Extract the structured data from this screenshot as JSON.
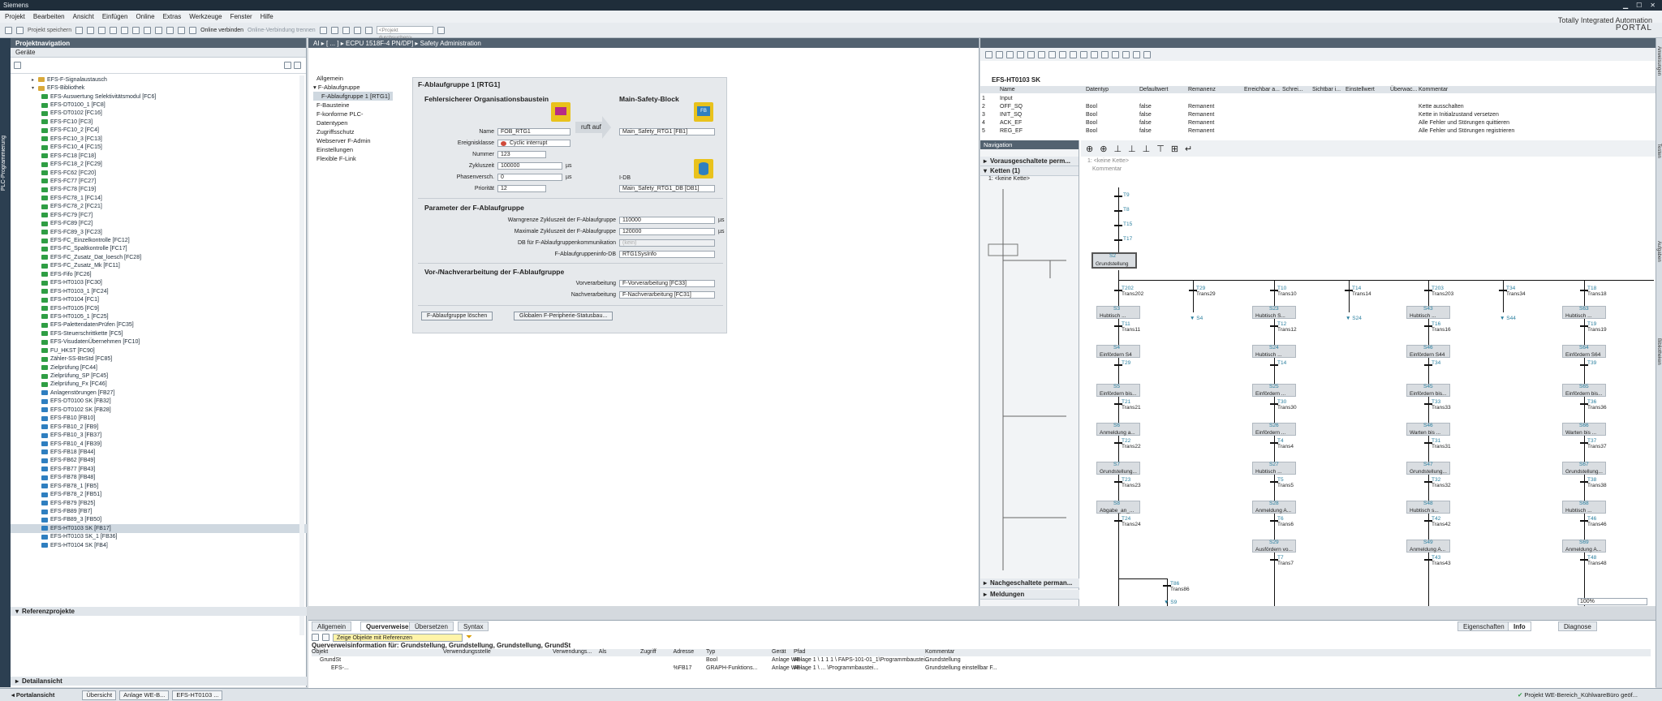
{
  "titlebar": {
    "title": "Siemens"
  },
  "menubar": {
    "items": [
      "Projekt",
      "Bearbeiten",
      "Ansicht",
      "Einfügen",
      "Online",
      "Extras",
      "Werkzeuge",
      "Fenster",
      "Hilfe"
    ]
  },
  "toolbar": {
    "save_label": "Projekt speichern",
    "online_label": "Online verbinden",
    "offline_label": "Online-Verbindung trennen",
    "search_placeholder": "<Projekt durchsuchen>"
  },
  "brand": {
    "line1": "Totally Integrated Automation",
    "line2": "PORTAL"
  },
  "sidestrip": {
    "label": "PLC-Programmierung"
  },
  "projnav": {
    "title": "Projektnavigation",
    "tab": "Geräte",
    "items": [
      {
        "label": "EFS-F-Signalaustausch",
        "kind": "folder",
        "arrow": "▸"
      },
      {
        "label": "EFS-Bibliothek",
        "kind": "folder",
        "arrow": "▾"
      },
      {
        "label": "EFS-Auswertung Selektivitätsmodul [FC6]",
        "kind": "fc"
      },
      {
        "label": "EFS-DT0100_1 [FC8]",
        "kind": "fc"
      },
      {
        "label": "EFS-DT0102 [FC16]",
        "kind": "fc"
      },
      {
        "label": "EFS-FC10 [FC3]",
        "kind": "fc"
      },
      {
        "label": "EFS-FC10_2 [FC4]",
        "kind": "fc"
      },
      {
        "label": "EFS-FC10_3 [FC13]",
        "kind": "fc"
      },
      {
        "label": "EFS-FC10_4 [FC15]",
        "kind": "fc"
      },
      {
        "label": "EFS-FC18 [FC18]",
        "kind": "fc"
      },
      {
        "label": "EFS-FC18_2 [FC29]",
        "kind": "fc"
      },
      {
        "label": "EFS-FC62 [FC20]",
        "kind": "fc"
      },
      {
        "label": "EFS-FC77 [FC27]",
        "kind": "fc"
      },
      {
        "label": "EFS-FC78 [FC19]",
        "kind": "fc"
      },
      {
        "label": "EFS-FC78_1 [FC14]",
        "kind": "fc"
      },
      {
        "label": "EFS-FC78_2 [FC21]",
        "kind": "fc"
      },
      {
        "label": "EFS-FC79 [FC7]",
        "kind": "fc"
      },
      {
        "label": "EFS-FC89 [FC2]",
        "kind": "fc"
      },
      {
        "label": "EFS-FC89_3 [FC23]",
        "kind": "fc"
      },
      {
        "label": "EFS-FC_Einzelkontrolle [FC12]",
        "kind": "fc"
      },
      {
        "label": "EFS-FC_Spaltkontrolle [FC17]",
        "kind": "fc"
      },
      {
        "label": "EFS-FC_Zusatz_Dat_loesch [FC28]",
        "kind": "fc"
      },
      {
        "label": "EFS-FC_Zusatz_Mk [FC11]",
        "kind": "fc"
      },
      {
        "label": "EFS-Fifo [FC26]",
        "kind": "fc"
      },
      {
        "label": "EFS-HT0103 [FC30]",
        "kind": "fc"
      },
      {
        "label": "EFS-HT0103_1 [FC24]",
        "kind": "fc"
      },
      {
        "label": "EFS-HT0104 [FC1]",
        "kind": "fc"
      },
      {
        "label": "EFS-HT0105 [FC9]",
        "kind": "fc"
      },
      {
        "label": "EFS-HT0105_1 [FC25]",
        "kind": "fc"
      },
      {
        "label": "EFS-PalettendatenPrüfen [FC35]",
        "kind": "fc"
      },
      {
        "label": "EFS-Steuerschrittkette [FC5]",
        "kind": "fc"
      },
      {
        "label": "EFS-VisudatenÜbernehmen [FC10]",
        "kind": "fc"
      },
      {
        "label": "FU_HKST [FC90]",
        "kind": "fc"
      },
      {
        "label": "Zähler-SS-BtrStd [FC85]",
        "kind": "fc"
      },
      {
        "label": "Zielprüfung [FC44]",
        "kind": "fc"
      },
      {
        "label": "Zielprüfung_SP [FC45]",
        "kind": "fc"
      },
      {
        "label": "Zielprüfung_Fx [FC46]",
        "kind": "fc"
      },
      {
        "label": "Anlagenstörungen [FB27]",
        "kind": "fb"
      },
      {
        "label": "EFS-DT0100 SK [FB32]",
        "kind": "fb"
      },
      {
        "label": "EFS-DT0102 SK [FB28]",
        "kind": "fb"
      },
      {
        "label": "EFS-FB10 [FB10]",
        "kind": "fb"
      },
      {
        "label": "EFS-FB10_2 [FB9]",
        "kind": "fb"
      },
      {
        "label": "EFS-FB10_3 [FB37]",
        "kind": "fb"
      },
      {
        "label": "EFS-FB10_4 [FB39]",
        "kind": "fb"
      },
      {
        "label": "EFS-FB18 [FB44]",
        "kind": "fb"
      },
      {
        "label": "EFS-FB62 [FB49]",
        "kind": "fb"
      },
      {
        "label": "EFS-FB77 [FB43]",
        "kind": "fb"
      },
      {
        "label": "EFS-FB78 [FB48]",
        "kind": "fb"
      },
      {
        "label": "EFS-FB78_1 [FB5]",
        "kind": "fb"
      },
      {
        "label": "EFS-FB78_2 [FB51]",
        "kind": "fb"
      },
      {
        "label": "EFS-FB79 [FB25]",
        "kind": "fb"
      },
      {
        "label": "EFS-FB89 [FB7]",
        "kind": "fb"
      },
      {
        "label": "EFS-FB89_3 [FB50]",
        "kind": "fb"
      },
      {
        "label": "EFS-HT0103 SK [FB17]",
        "kind": "fb",
        "selected": true
      },
      {
        "label": "EFS-HT0103 SK_1 [FB36]",
        "kind": "fb"
      },
      {
        "label": "EFS-HT0104 SK [FB4]",
        "kind": "fb"
      }
    ],
    "ref_title": "Referenzprojekte",
    "detail_title": "Detailansicht"
  },
  "editor1": {
    "breadcrumb": "AI ▸ [ ... ] ▸ ECPU 1518F-4 PN/DP] ▸ Safety Administration",
    "nav": [
      {
        "label": "Allgemein"
      },
      {
        "label": "F-Ablaufgruppe",
        "arrow": "▾"
      },
      {
        "label": "F-Ablaufgruppe 1 [RTG1]",
        "indent": true,
        "selected": true
      },
      {
        "label": "F-Bausteine"
      },
      {
        "label": "F-konforme PLC-Datentypen"
      },
      {
        "label": "Zugriffsschutz"
      },
      {
        "label": "Webserver F-Admin"
      },
      {
        "label": "Einstellungen"
      },
      {
        "label": "Flexible F-Link"
      }
    ],
    "group_title": "F-Ablaufgruppe 1 [RTG1]",
    "ob_section": "Fehlersicherer Organisationsbaustein",
    "main_section": "Main-Safety-Block",
    "calls_label": "ruft auf",
    "fields": {
      "name_label": "Name",
      "name": "FOB_RTG1",
      "event_label": "Ereignisklasse",
      "event": "Cyclic interrupt",
      "number_label": "Nummer",
      "number": "123",
      "cycle_label": "Zykluszeit",
      "cycle": "100000",
      "cycle_unit": "µs",
      "phase_label": "Phasenversch.",
      "phase": "0",
      "phase_unit": "µs",
      "prio_label": "Priorität",
      "prio": "12"
    },
    "main_block": "Main_Safety_RTG1 [FB1]",
    "idb_label": "I-DB",
    "idb": "Main_Safety_RTG1_DB [DB1]",
    "params_section": "Parameter der F-Ablaufgruppe",
    "params": [
      {
        "label": "Warngrenze Zykluszeit der F-Ablaufgruppe",
        "value": "110000",
        "unit": "µs"
      },
      {
        "label": "Maximale Zykluszeit der F-Ablaufgruppe",
        "value": "120000",
        "unit": "µs"
      },
      {
        "label": "DB für F-Ablaufgruppenkommunikation",
        "value": "(kein)",
        "unit": ""
      },
      {
        "label": "F-Ablaufgruppeninfo-DB",
        "value": "RTG1SysInfo",
        "unit": ""
      }
    ],
    "prepost_section": "Vor-/Nachverarbeitung der F-Ablaufgruppe",
    "pre_label": "Vorverarbeitung",
    "pre": "F-Vorverarbeitung [FC33]",
    "post_label": "Nachverarbeitung",
    "post": "F-Nachverarbeitung [FC31]",
    "delete_btn": "F-Ablaufgruppe löschen",
    "periph_btn": "Globalen F-Peripherie-Statusbau..."
  },
  "editor2": {
    "block_title": "EFS-HT0103 SK",
    "iface_headers": [
      "Name",
      "Datentyp",
      "Defaultwert",
      "Remanenz",
      "Erreichbar a...",
      "Schrei...",
      "Sichtbar i...",
      "Einstellwert",
      "Überwac...",
      "Kommentar"
    ],
    "iface_rows": [
      {
        "num": "1",
        "name": "Input",
        "type": "",
        "def": "",
        "rem": "",
        "comment": ""
      },
      {
        "num": "2",
        "name": "OFF_SQ",
        "type": "Bool",
        "def": "false",
        "rem": "Remanent",
        "comment": "Kette ausschalten"
      },
      {
        "num": "3",
        "name": "INIT_SQ",
        "type": "Bool",
        "def": "false",
        "rem": "Remanent",
        "comment": "Kette in Initialzustand versetzen"
      },
      {
        "num": "4",
        "name": "ACK_EF",
        "type": "Bool",
        "def": "false",
        "rem": "Remanent",
        "comment": "Alle Fehler und Störungen quittieren"
      },
      {
        "num": "5",
        "name": "REG_EF",
        "type": "Bool",
        "def": "false",
        "rem": "Remanent",
        "comment": "Alle Fehler und Störungen registrieren"
      }
    ],
    "nav_title": "Navigation",
    "pre_chains": "Vorausgeschaltete perm...",
    "chains": "Ketten (1)",
    "chain1": "1: <keine Kette>",
    "post_chains": "Nachgeschaltete perman...",
    "messages": "Meldungen",
    "seq_chain": "1: <keine Kette>",
    "seq_comment": "Kommentar",
    "zoom": "100%",
    "top_transitions": [
      "T9",
      "T8",
      "T15",
      "T17"
    ],
    "main_step": {
      "num": "S2",
      "label": "Grundstellung"
    },
    "columns": [
      {
        "t": "T202",
        "tl": "Trans202",
        "steps": [
          [
            "S3",
            "Hubtisch ..."
          ],
          [
            "S4",
            "Einfördern S4"
          ],
          [
            "S5",
            "Einfördern bis..."
          ],
          [
            "S6",
            "Anmeldung a..."
          ],
          [
            "S7",
            "Grundstellung..."
          ],
          [
            "S8",
            "Abgabe_an_..."
          ]
        ],
        "trans": [
          [
            "T11",
            "Trans11"
          ],
          [
            "T29",
            ""
          ],
          [
            "T21",
            "Trans21"
          ],
          [
            "T22",
            "Trans22"
          ],
          [
            "T23",
            "Trans23"
          ],
          [
            "T24",
            "Trans24"
          ],
          [
            "T25",
            "Trans25"
          ]
        ]
      },
      {
        "t": "T29",
        "tl": "Trans29",
        "jump": "S4"
      },
      {
        "t": "T10",
        "tl": "Trans10",
        "steps": [
          [
            "S23",
            "Hubtisch S..."
          ],
          [
            "S24",
            "Hubtisch ..."
          ],
          [
            "S25",
            "Einfördern ..."
          ],
          [
            "S26",
            "Einfördern ..."
          ],
          [
            "S27",
            "Hubtisch ..."
          ],
          [
            "S28",
            "Anmeldung A..."
          ],
          [
            "S29",
            "Ausfördern vo..."
          ]
        ],
        "trans": [
          [
            "T12",
            "Trans12"
          ],
          [
            "T14",
            ""
          ],
          [
            "T30",
            "Trans30"
          ],
          [
            "T4",
            "Trans4"
          ],
          [
            "T5",
            "Trans5"
          ],
          [
            "T6",
            "Trans6"
          ],
          [
            "T7",
            "Trans7"
          ]
        ]
      },
      {
        "t": "T14",
        "tl": "Trans14",
        "jump": "S24"
      },
      {
        "t": "T203",
        "tl": "Trans203",
        "steps": [
          [
            "S43",
            "Hubtisch ..."
          ],
          [
            "S46",
            "Einfördern S44"
          ],
          [
            "S45",
            "Einfördern bis..."
          ],
          [
            "S46",
            "Warten bis ..."
          ],
          [
            "S47",
            "Grundstellung..."
          ],
          [
            "S48",
            "Hubtisch s..."
          ],
          [
            "S49",
            "Anmeldung A..."
          ]
        ],
        "trans": [
          [
            "T16",
            "Trans16"
          ],
          [
            "T34",
            ""
          ],
          [
            "T33",
            "Trans33"
          ],
          [
            "T31",
            "Trans31"
          ],
          [
            "T32",
            "Trans32"
          ],
          [
            "T42",
            "Trans42"
          ],
          [
            "T43",
            "Trans43"
          ]
        ]
      },
      {
        "t": "T34",
        "tl": "Trans34",
        "jump": "S44"
      },
      {
        "t": "T18",
        "tl": "Trans18",
        "steps": [
          [
            "S63",
            "Hubtisch ..."
          ],
          [
            "S64",
            "Einfördern S64"
          ],
          [
            "S65",
            "Einfördern bis..."
          ],
          [
            "S66",
            "Warten bis ..."
          ],
          [
            "S67",
            "Grundstellung..."
          ],
          [
            "S68",
            "Hubtisch ..."
          ],
          [
            "S69",
            "Anmeldung A..."
          ]
        ],
        "trans": [
          [
            "T19",
            "Trans19"
          ],
          [
            "T39",
            ""
          ],
          [
            "T36",
            "Trans36"
          ],
          [
            "T37",
            "Trans37"
          ],
          [
            "T38",
            "Trans38"
          ],
          [
            "T46",
            "Trans46"
          ],
          [
            "T48",
            "Trans48"
          ]
        ]
      }
    ],
    "bottom_trans": {
      "t": "T86",
      "tl": "Trans86",
      "jump": "S9"
    }
  },
  "bottom": {
    "tabs": [
      "Allgemein",
      "Querverweise",
      "Übersetzen",
      "Syntax"
    ],
    "filter": "Zeige Objekte mit Referenzen",
    "info_line": "Querverweisinformation für: Grundstellung, Grundstellung, Grundstellung, GrundSt",
    "headers": [
      "Objekt",
      "Verwendungsstelle",
      "Verwendungs...",
      "Als",
      "Zugriff",
      "Adresse",
      "Typ",
      "Gerät",
      "Pfad",
      "Kommentar"
    ],
    "row1": {
      "obj": "GrundSt",
      "typ": "Bool",
      "geraet": "Anlage WE-...",
      "pfad": "Anlage 1 \\ 1 1 1 \\ FAPS-101-01_1\\Programmbaustei...",
      "kommentar": "Grundstellung"
    },
    "row2": {
      "obj": "EFS-...",
      "adresse": "%FB17",
      "typ": "GRAPH-Funktions...",
      "geraet": "Anlage WE-...",
      "pfad": "Anlage 1 \\ ... \\Programmbaustei...",
      "kommentar": "Grundstellung einstellbar F..."
    },
    "right_tabs": [
      "Eigenschaften",
      "Info",
      "Diagnose"
    ]
  },
  "taskbar": {
    "portal": "Portalansicht",
    "tasks": [
      "Übersicht",
      "Anlage WE-B...",
      "EFS-HT0103 ..."
    ],
    "status": "Projekt WE-Bereich_KühlwareBüro geöf..."
  },
  "rightstrip": {
    "tabs": [
      "Anweisungen",
      "Testen",
      "Aufgaben",
      "Bibliotheken"
    ]
  },
  "colors": {
    "panelhead": "#536270",
    "accent": "#2a7f9f",
    "fc_icon": "#2f9e44",
    "fb_icon": "#2f7fc0"
  }
}
